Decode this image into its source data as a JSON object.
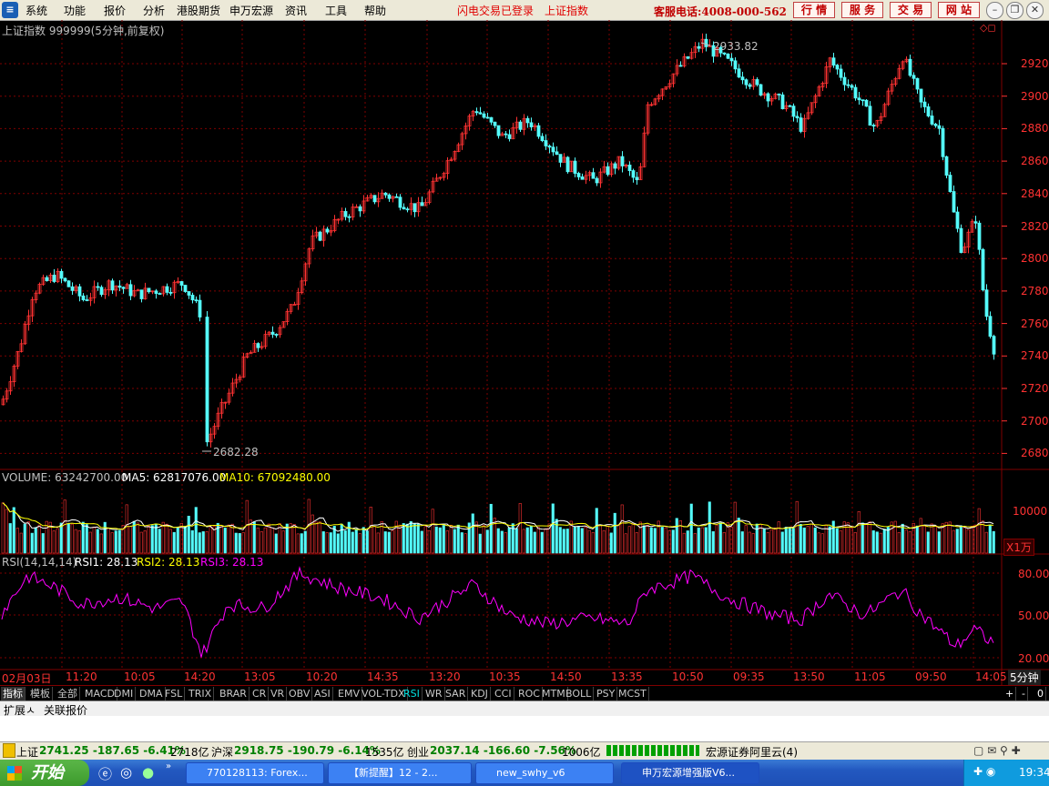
{
  "menu": {
    "items": [
      "系统",
      "功能",
      "报价",
      "分析",
      "港股期货",
      "申万宏源",
      "资讯",
      "工具",
      "帮助"
    ],
    "status_login": "闪电交易已登录",
    "status_index": "上证指数",
    "hotline": "客服电话:4008-000-562",
    "buttons": [
      "行 情",
      "服 务",
      "交 易",
      "网 站"
    ]
  },
  "main": {
    "title": "上证指数 999999(5分钟,前复权)",
    "high_label": "2933.82",
    "low_label": "2682.28",
    "price_ticks": [
      "2920",
      "2900",
      "2880",
      "2860",
      "2840",
      "2820",
      "2800",
      "2780",
      "2760",
      "2740",
      "2720",
      "2700",
      "2680"
    ]
  },
  "volume": {
    "label": "VOLUME: 63242700.00",
    "ma5": "MA5: 62817076.00",
    "ma10": "MA10: 67092480.00",
    "tick": "10000",
    "unit": "X1万"
  },
  "rsi": {
    "label": "RSI(14,14,14)",
    "rsi1": "RSI1: 28.13",
    "rsi2": "RSI2: 28.13",
    "rsi3": "RSI3: 28.13",
    "ticks": [
      "80.00",
      "50.00",
      "20.00"
    ]
  },
  "time_axis": {
    "labels": [
      "02月03日",
      "11:20",
      "10:05",
      "14:20",
      "13:05",
      "10:20",
      "14:35",
      "13:20",
      "10:35",
      "14:50",
      "13:35",
      "10:50",
      "09:35",
      "13:50",
      "11:05",
      "09:50",
      "14:05"
    ],
    "period": "5分钟"
  },
  "indicator_tabs": [
    "指标",
    "模板",
    "全部",
    "MACD",
    "DMI",
    "DMA",
    "FSL",
    "TRIX",
    "BRAR",
    "CR",
    "VR",
    "OBV",
    "ASI",
    "EMV",
    "VOL-TDX",
    "RSI",
    "WR",
    "SAR",
    "KDJ",
    "CCI",
    "ROC",
    "MTM",
    "BOLL",
    "PSY",
    "MCST"
  ],
  "tab_controls": [
    "+",
    "-",
    "0"
  ],
  "bottom_tabs": [
    "扩展ㅅ",
    "关联报价"
  ],
  "status": {
    "sh_name": "上证",
    "sh_value": "2741.25 -187.65 -6.41%",
    "sh_amount": "2718亿",
    "hs_name": "沪深",
    "hs_value": "2918.75 -190.79 -6.14%",
    "hs_amount": "1535亿",
    "cy_name": "创业",
    "cy_value": "2037.14 -166.60 -7.56%",
    "cy_amount": "1006亿",
    "server": "宏源证券阿里云(4)"
  },
  "taskbar": {
    "start": "开始",
    "tasks": [
      "770128113: Forex...",
      "【新提醒】12 - 2...",
      "new_swhy_v6",
      "申万宏源增强版V6..."
    ],
    "clock": "19:34"
  },
  "colors": {
    "up": "#ff3232",
    "down": "#54fcfc",
    "ma5": "#ffffff",
    "ma10": "#ffff00",
    "rsi": "#ff00ff",
    "grid": "#800000"
  }
}
